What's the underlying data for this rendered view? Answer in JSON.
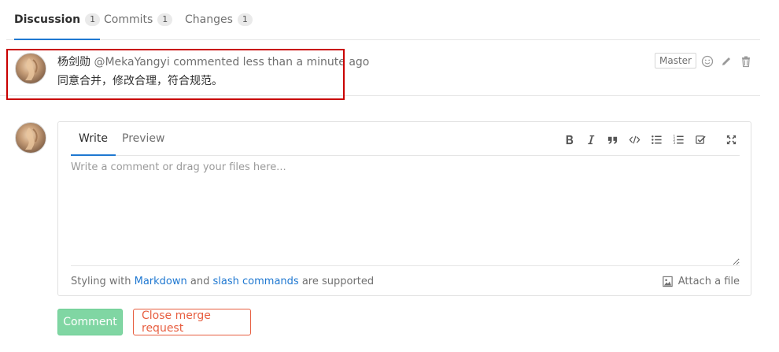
{
  "tabs": [
    {
      "label": "Discussion",
      "count": "1"
    },
    {
      "label": "Commits",
      "count": "1"
    },
    {
      "label": "Changes",
      "count": "1"
    }
  ],
  "note": {
    "author": "杨剑勋",
    "handle": "@MekaYangyi",
    "meta": "commented less than a minute ago",
    "body": "同意合并，修改合理，符合规范。",
    "role": "Master"
  },
  "icons": {
    "emoji": "smiley-icon",
    "edit": "pencil-icon",
    "delete": "trash-icon"
  },
  "form": {
    "tab_write": "Write",
    "tab_preview": "Preview",
    "placeholder": "Write a comment or drag your files here...",
    "footer_prefix": "Styling with",
    "footer_markdown": "Markdown",
    "footer_and": "and",
    "footer_slash": "slash commands",
    "footer_suffix": "are supported",
    "attach": "Attach a file"
  },
  "buttons": {
    "comment": "Comment",
    "close": "Close merge request"
  },
  "colors": {
    "accent": "#1f78d1",
    "comment_button": "#80d6a3",
    "close_button": "#e75e40",
    "highlight": "#c90000"
  }
}
